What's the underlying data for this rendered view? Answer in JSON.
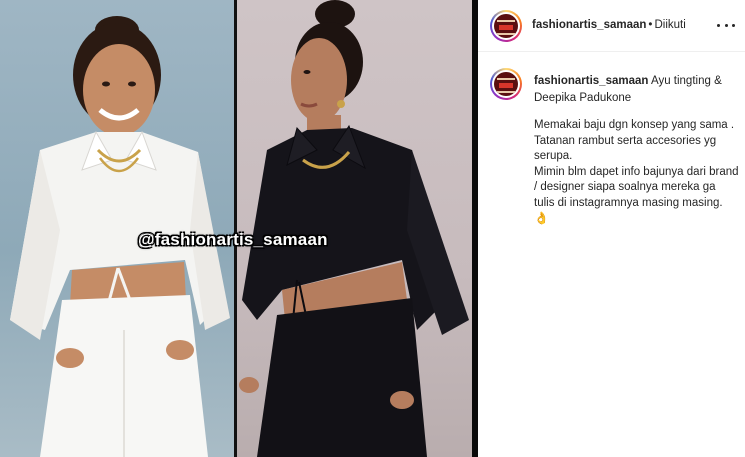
{
  "post": {
    "username": "fashionartis_samaan",
    "separator": "•",
    "follow_status": "Diikuti",
    "watermark": "@fashionartis_samaan",
    "caption": {
      "title": "Ayu tingting & Deepika Padukone",
      "lines": [
        "Memakai baju dgn konsep yang sama . Tatanan rambut serta accesories yg serupa.",
        "Mimin blm dapet info bajunya dari brand / designer siapa soalnya mereka ga tulis di instagramnya masing masing."
      ],
      "emoji": "👌"
    }
  },
  "icons": {
    "more": "more-options-icon",
    "avatar": "profile-avatar"
  },
  "colors": {
    "text": "#262626",
    "divider": "#efefef",
    "white_outfit": "#f4f4f2",
    "black_outfit": "#15141a"
  }
}
